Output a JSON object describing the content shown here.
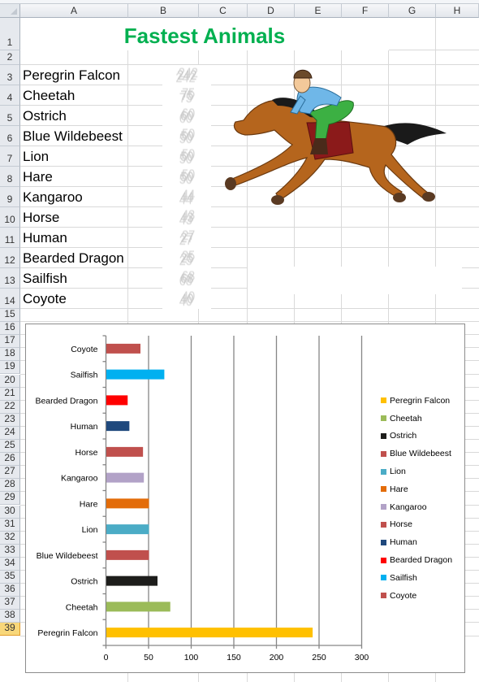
{
  "spreadsheet": {
    "columns": [
      "A",
      "B",
      "C",
      "D",
      "E",
      "F",
      "G",
      "H"
    ],
    "rows": [
      "1",
      "2",
      "3",
      "4",
      "5",
      "6",
      "7",
      "8",
      "9",
      "10",
      "11",
      "12",
      "13",
      "14",
      "15",
      "16",
      "17",
      "18",
      "19",
      "20",
      "21",
      "22",
      "23",
      "24",
      "25",
      "26",
      "27",
      "28",
      "29",
      "30",
      "31",
      "32",
      "33",
      "34",
      "35",
      "36",
      "37",
      "38",
      "39"
    ],
    "selected_row": "39",
    "title": "Fastest Animals",
    "title_color": "#00b050",
    "animals": [
      {
        "name": "Peregrin Falcon",
        "speed": "242"
      },
      {
        "name": "Cheetah",
        "speed": "75"
      },
      {
        "name": "Ostrich",
        "speed": "60"
      },
      {
        "name": "Blue Wildebeest",
        "speed": "50"
      },
      {
        "name": "Lion",
        "speed": "50"
      },
      {
        "name": "Hare",
        "speed": "50"
      },
      {
        "name": "Kangaroo",
        "speed": "44"
      },
      {
        "name": "Horse",
        "speed": "43"
      },
      {
        "name": "Human",
        "speed": "27"
      },
      {
        "name": "Bearded Dragon",
        "speed": "25"
      },
      {
        "name": "Sailfish",
        "speed": "68"
      },
      {
        "name": "Coyote",
        "speed": "40"
      }
    ],
    "picture": "horse-and-jockey-clipart"
  },
  "chart_data": {
    "type": "bar",
    "orientation": "horizontal",
    "title": "",
    "xlabel": "",
    "ylabel": "",
    "categories": [
      "Peregrin Falcon",
      "Cheetah",
      "Ostrich",
      "Blue Wildebeest",
      "Lion",
      "Hare",
      "Kangaroo",
      "Horse",
      "Human",
      "Bearded Dragon",
      "Sailfish",
      "Coyote"
    ],
    "values": [
      242,
      75,
      60,
      50,
      50,
      50,
      44,
      43,
      27,
      25,
      68,
      40
    ],
    "colors": [
      "#ffc000",
      "#9bbb59",
      "#1d1d1b",
      "#c0504d",
      "#4bacc6",
      "#e36c09",
      "#b2a2c7",
      "#c0504d",
      "#1f497d",
      "#ff0000",
      "#00b0f0",
      "#c0504d"
    ],
    "xlim": [
      0,
      300
    ],
    "xticks": [
      "0",
      "50",
      "100",
      "150",
      "200",
      "250",
      "300"
    ],
    "grid": true,
    "legend_position": "right",
    "legend": [
      "Peregrin Falcon",
      "Cheetah",
      "Ostrich",
      "Blue Wildebeest",
      "Lion",
      "Hare",
      "Kangaroo",
      "Horse",
      "Human",
      "Bearded Dragon",
      "Sailfish",
      "Coyote"
    ]
  }
}
